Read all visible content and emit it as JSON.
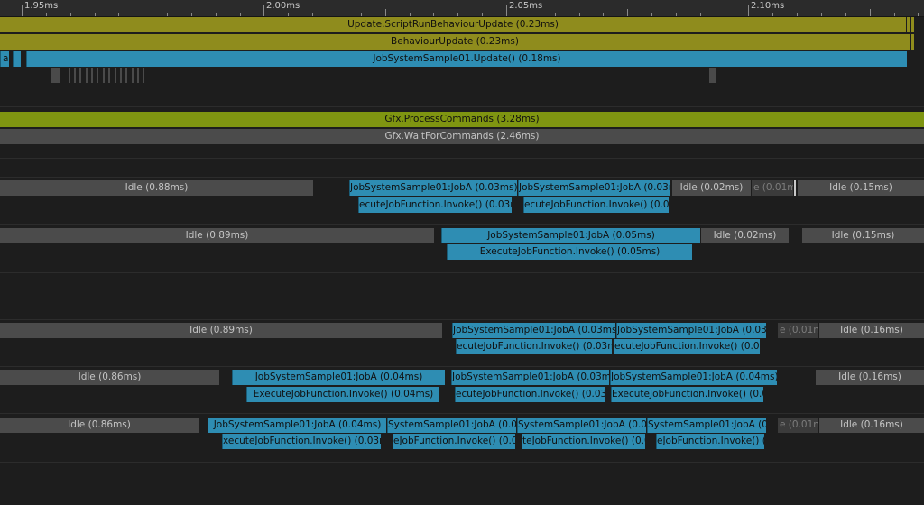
{
  "ruler": {
    "labels": [
      "1.95ms",
      "2.00ms",
      "2.05ms",
      "2.10ms"
    ]
  },
  "main_thread": {
    "update_script_run": "Update.ScriptRunBehaviourUpdate (0.23ms)",
    "behaviour_update": "BehaviourUpdate (0.23ms)",
    "job_update": "JobSystemSample01.Update() (0.18ms)",
    "job_update_left_fragment": "al"
  },
  "render_thread": {
    "process_commands": "Gfx.ProcessCommands (3.28ms)",
    "wait_for_commands": "Gfx.WaitForCommands (2.46ms)"
  },
  "workers": [
    {
      "idle1": "Idle (0.88ms)",
      "job1": "JobSystemSample01:JobA (0.03ms)",
      "job2": "JobSystemSample01:JobA (0.03ms",
      "idle2": "Idle (0.02ms)",
      "faint": "e (0.01m",
      "idle3": "Idle (0.15ms)",
      "exec1": "ecuteJobFunction.Invoke() (0.03m",
      "exec2": "ecuteJobFunction.Invoke() (0.03r"
    },
    {
      "idle1": "Idle (0.89ms)",
      "job1": "JobSystemSample01:JobA (0.05ms)",
      "idle2": "Idle (0.02ms)",
      "idle3": "Idle (0.15ms)",
      "exec1": "ExecuteJobFunction.Invoke() (0.05ms)"
    },
    {
      "idle1": "Idle (0.89ms)",
      "job1": "JobSystemSample01:JobA (0.03ms)",
      "job2": "JobSystemSample01:JobA (0.03ms",
      "faint": "e (0.01m",
      "idle3": "Idle (0.16ms)",
      "exec1": "ecuteJobFunction.Invoke() (0.03m",
      "exec2": "ecuteJobFunction.Invoke() (0.03m"
    },
    {
      "idle1": "Idle (0.86ms)",
      "job1": "JobSystemSample01:JobA (0.04ms)",
      "job2": "JobSystemSample01:JobA (0.03ms)",
      "job3": "JobSystemSample01:JobA (0.04ms)",
      "idle3": "Idle (0.16ms)",
      "exec1": "ExecuteJobFunction.Invoke() (0.04ms)",
      "exec2": "ecuteJobFunction.Invoke() (0.03m",
      "exec3": "ExecuteJobFunction.Invoke() (0.03m"
    },
    {
      "idle1": "Idle (0.86ms)",
      "job1": "JobSystemSample01:JobA (0.04ms)",
      "job2": "SystemSample01:JobA (0.03",
      "job3": "SystemSample01:JobA (0.03",
      "job4": "SystemSample01:JobA (0.0",
      "faint": "e (0.01m",
      "idle3": "Idle (0.16ms)",
      "exec1": "xecuteJobFunction.Invoke() (0.03ms)",
      "exec2": "eJobFunction.Invoke() (0.0",
      "exec3": "teJobFunction.Invoke() (0.0",
      "exec4": "eJobFunction.Invoke() (0"
    }
  ],
  "colors": {
    "background": "#1d1d1d",
    "yellow_marker": "#8f8c1d",
    "green_marker": "#7f9511",
    "job_blue": "#2e8db3",
    "idle_grey": "#4b4b4b"
  }
}
